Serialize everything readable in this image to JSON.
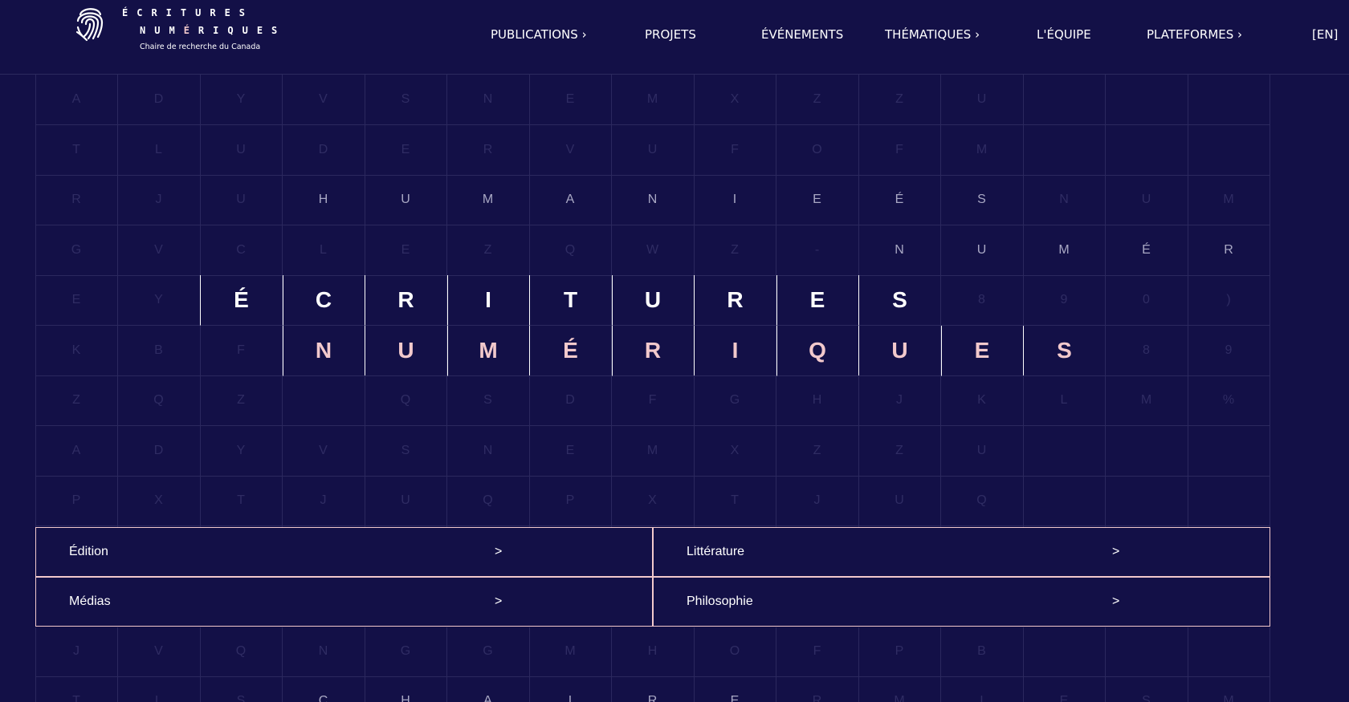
{
  "header": {
    "logo": {
      "line1": "ÉCRITURES",
      "line2_plain": "NUM",
      "line2_accent": "É",
      "line2_rest": "RIQUES",
      "subtitle": "Chaire de recherche du Canada",
      "icon": "fingerprint-icon"
    },
    "nav": [
      {
        "label": "PUBLICATIONS ›"
      },
      {
        "label": "PROJETS"
      },
      {
        "label": "ÉVÉNEMENTS"
      },
      {
        "label": "THÉMATIQUES ›"
      },
      {
        "label": "L'ÉQUIPE"
      },
      {
        "label": "PLATEFORMES ›"
      },
      {
        "label": "[EN]"
      }
    ]
  },
  "grid": {
    "rows": [
      [
        "A",
        "D",
        "Y",
        "V",
        "S",
        "N",
        "E",
        "M",
        "X",
        "Z",
        "Z",
        "U",
        "",
        "",
        ""
      ],
      [
        "T",
        "L",
        "U",
        "D",
        "E",
        "R",
        "V",
        "U",
        "F",
        "O",
        "F",
        "M",
        "",
        "",
        ""
      ],
      [
        "R",
        "J",
        "U",
        "H",
        "U",
        "M",
        "A",
        "N",
        "I",
        "E",
        "É",
        "S",
        "N",
        "U",
        "M"
      ],
      [
        "G",
        "V",
        "C",
        "L",
        "E",
        "Z",
        "Q",
        "W",
        "Z",
        "-",
        "N",
        "U",
        "M",
        "É",
        "R"
      ],
      [
        "E",
        "Y",
        "É",
        "C",
        "R",
        "I",
        "T",
        "U",
        "R",
        "E",
        "S",
        "8",
        "9",
        "0",
        ")"
      ],
      [
        "K",
        "B",
        "F",
        "N",
        "U",
        "M",
        "É",
        "R",
        "I",
        "Q",
        "U",
        "E",
        "S",
        "8",
        "9"
      ],
      [
        "Z",
        "Q",
        "Z",
        "",
        "Q",
        "S",
        "D",
        "F",
        "G",
        "H",
        "J",
        "K",
        "L",
        "M",
        "%"
      ],
      [
        "A",
        "D",
        "Y",
        "V",
        "S",
        "N",
        "E",
        "M",
        "X",
        "Z",
        "Z",
        "U",
        "",
        "",
        ""
      ],
      [
        "P",
        "X",
        "T",
        "J",
        "U",
        "Q",
        "P",
        "X",
        "T",
        "J",
        "U",
        "Q",
        "",
        "",
        ""
      ],
      [
        "",
        "",
        "",
        "",
        "",
        "",
        "",
        "",
        "",
        "",
        "",
        "",
        "",
        "",
        ""
      ],
      [
        "",
        "",
        "",
        "",
        "",
        "",
        "",
        "",
        "",
        "",
        "",
        "",
        "",
        "",
        ""
      ],
      [
        "J",
        "V",
        "Q",
        "N",
        "G",
        "G",
        "M",
        "H",
        "O",
        "F",
        "P",
        "B",
        "",
        "",
        ""
      ],
      [
        "T",
        "L",
        "S",
        "C",
        "H",
        "A",
        "I",
        "R",
        "E",
        "R",
        "M",
        "I",
        "E",
        "S",
        "M"
      ]
    ]
  },
  "thematiques": {
    "items": [
      {
        "label": "Édition",
        "arrow": ">"
      },
      {
        "label": "Littérature",
        "arrow": ">"
      },
      {
        "label": "Médias",
        "arrow": ">"
      },
      {
        "label": "Philosophie",
        "arrow": ">"
      }
    ]
  },
  "colors": {
    "background": "#131047",
    "accent_pink": "#f2c9cc",
    "grid_line": "#2b285e",
    "faint_letter": "#2f2c63"
  }
}
